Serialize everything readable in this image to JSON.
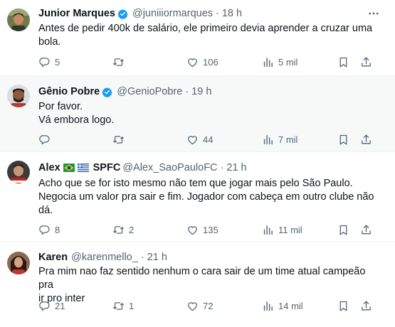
{
  "tweets": [
    {
      "name": "Junior Marques",
      "handle": "@juniiiormarques",
      "separator": "·",
      "time": "18 h",
      "text": [
        "Antes de pedir 400k de salário, ele primeiro devia aprender a cruzar uma",
        "bola."
      ],
      "replies": "5",
      "retweets": "",
      "likes": "106",
      "views": "5 mil"
    },
    {
      "name": "Gênio Pobre",
      "handle": "@GenioPobre",
      "separator": "·",
      "time": "19 h",
      "text": [
        "Por favor.",
        "Vá embora logo."
      ],
      "replies": "",
      "retweets": "",
      "likes": "44",
      "views": "7 mil"
    },
    {
      "name": "Alex",
      "name_suffix": "SPFC",
      "handle": "@Alex_SaoPauloFC",
      "separator": "·",
      "time": "21 h",
      "text": [
        "Acho que se for isto mesmo não tem que jogar mais pelo São Paulo.",
        "Negocia um valor pra sair e fim. Jogador com cabeça em outro clube não",
        "dá."
      ],
      "replies": "8",
      "retweets": "2",
      "likes": "135",
      "views": "11 mil"
    },
    {
      "name": "Karen",
      "handle": "@karenmello_",
      "separator": "·",
      "time": "21 h",
      "text": [
        "Pra mim nao faz sentido nenhum o cara sair de um time atual campeão pra",
        "ir pro inter"
      ],
      "replies": "21",
      "retweets": "1",
      "likes": "72",
      "views": "14 mil"
    }
  ],
  "colors": {
    "text": "#0f1419",
    "secondary": "#536471",
    "verified": "#1d9bf0",
    "highlight_bg": "#f7f9f9",
    "divider": "#eff3f4"
  },
  "icons": [
    "reply-icon",
    "retweet-icon",
    "like-icon",
    "views-icon",
    "bookmark-icon",
    "share-icon",
    "more-icon",
    "verified-badge-icon",
    "brazil-flag-icon",
    "greece-flag-icon"
  ]
}
